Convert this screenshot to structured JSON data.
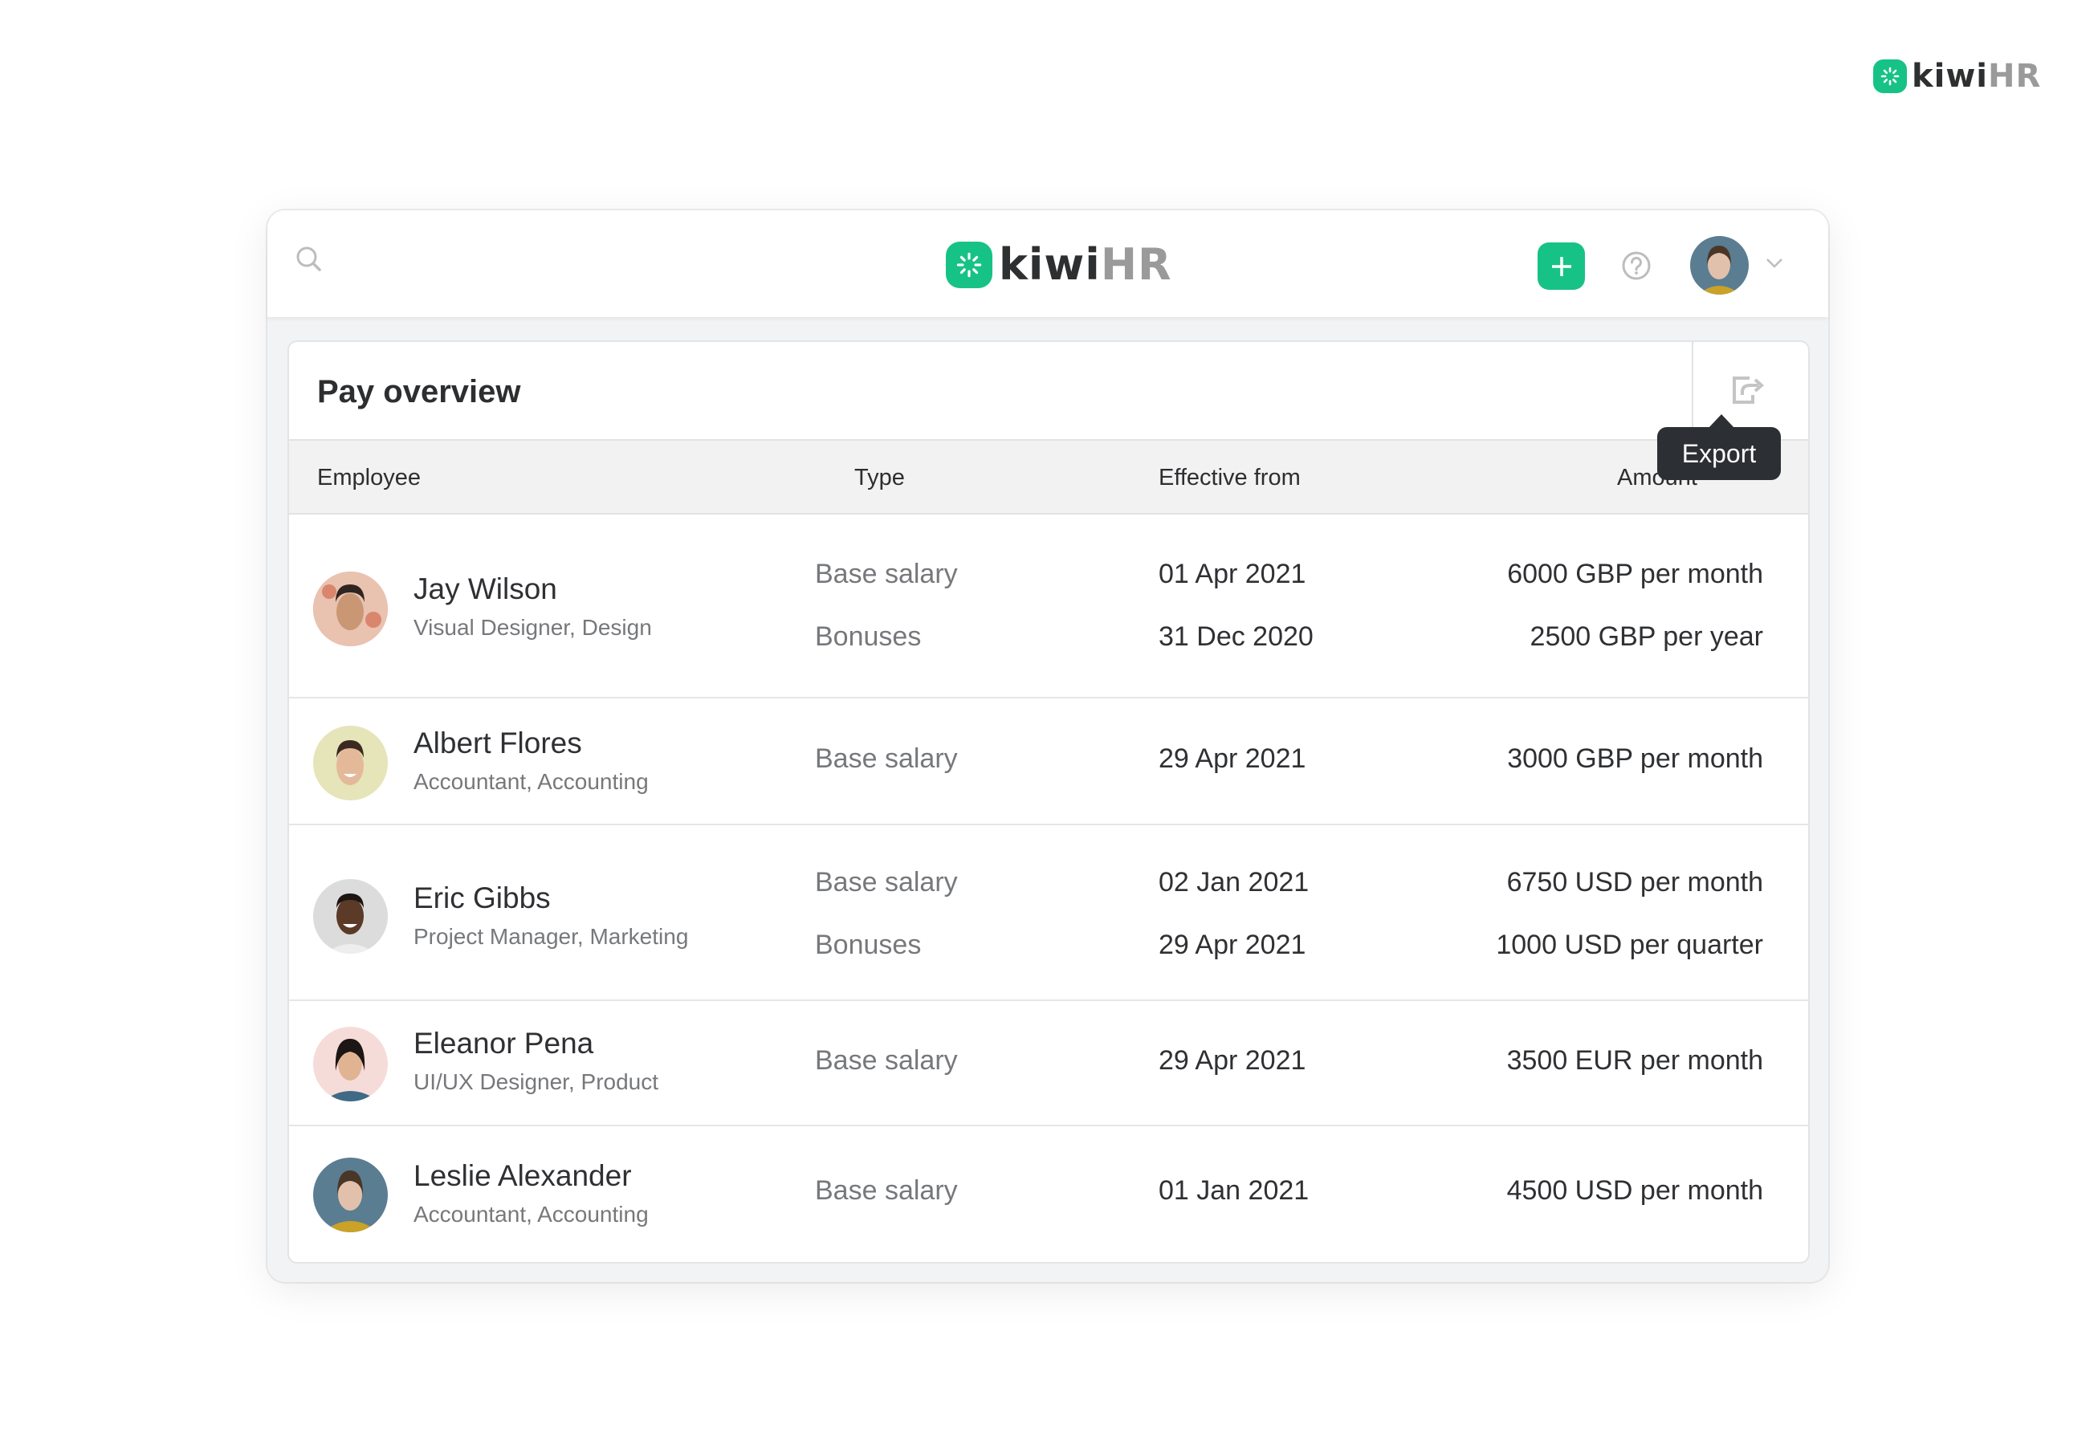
{
  "brand": {
    "kiwi": "kiwi",
    "hr": "HR",
    "accent_color": "#17c287"
  },
  "topbar": {
    "search_icon": "search-icon",
    "add_icon": "plus-icon",
    "help_icon": "question-circle-icon",
    "user_menu_icon": "chevron-down-icon"
  },
  "card": {
    "title": "Pay overview",
    "export_tooltip": "Export",
    "columns": [
      "Employee",
      "Type",
      "Effective from",
      "Amount"
    ]
  },
  "rows": [
    {
      "name": "Jay Wilson",
      "role": "Visual Designer, Design",
      "entries": [
        {
          "type": "Base salary",
          "date": "01 Apr 2021",
          "amount": "6000 GBP per month"
        },
        {
          "type": "Bonuses",
          "date": "31 Dec 2020",
          "amount": "2500 GBP per year"
        }
      ]
    },
    {
      "name": "Albert Flores",
      "role": "Accountant, Accounting",
      "entries": [
        {
          "type": "Base salary",
          "date": "29 Apr 2021",
          "amount": "3000 GBP per month"
        }
      ]
    },
    {
      "name": "Eric Gibbs",
      "role": "Project Manager, Marketing",
      "entries": [
        {
          "type": "Base salary",
          "date": "02 Jan 2021",
          "amount": "6750 USD per month"
        },
        {
          "type": "Bonuses",
          "date": "29 Apr 2021",
          "amount": "1000 USD per quarter"
        }
      ]
    },
    {
      "name": "Eleanor Pena",
      "role": "UI/UX Designer, Product",
      "entries": [
        {
          "type": "Base salary",
          "date": "29 Apr 2021",
          "amount": "3500 EUR per month"
        }
      ]
    },
    {
      "name": "Leslie Alexander",
      "role": "Accountant, Accounting",
      "entries": [
        {
          "type": "Base salary",
          "date": "01 Jan 2021",
          "amount": "4500 USD per month"
        }
      ]
    }
  ]
}
